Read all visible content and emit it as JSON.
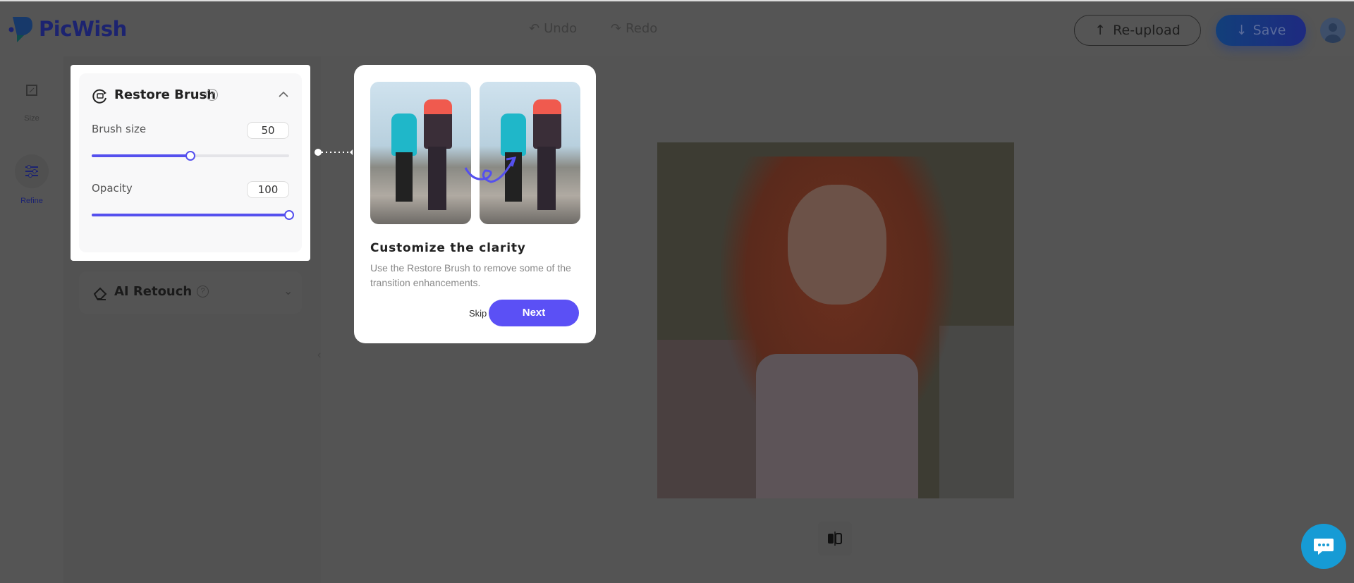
{
  "header": {
    "brand": "PicWish",
    "undo": "Undo",
    "redo": "Redo",
    "reupload": "Re-upload",
    "save": "Save"
  },
  "sidebar": {
    "items": [
      {
        "label": "Size",
        "icon": "crop-icon"
      },
      {
        "label": "Refine",
        "icon": "sliders-icon",
        "active": true
      }
    ]
  },
  "panel": {
    "restore_brush": {
      "title": "Restore Brush",
      "expanded": true,
      "brush_size": {
        "label": "Brush size",
        "value": "50",
        "fraction": 0.5
      },
      "opacity": {
        "label": "Opacity",
        "value": "100",
        "fraction": 1.0
      }
    },
    "ai_retouch": {
      "title": "AI Retouch",
      "expanded": false
    }
  },
  "tooltip": {
    "title": "Customize the clarity",
    "description": "Use the Restore Brush to remove some of the transition enhancements.",
    "skip": "Skip",
    "next": "Next"
  },
  "colors": {
    "accent": "#5550ee",
    "next_button": "#5b50f5",
    "chat": "#169bd5",
    "brand": "#1c2370"
  }
}
